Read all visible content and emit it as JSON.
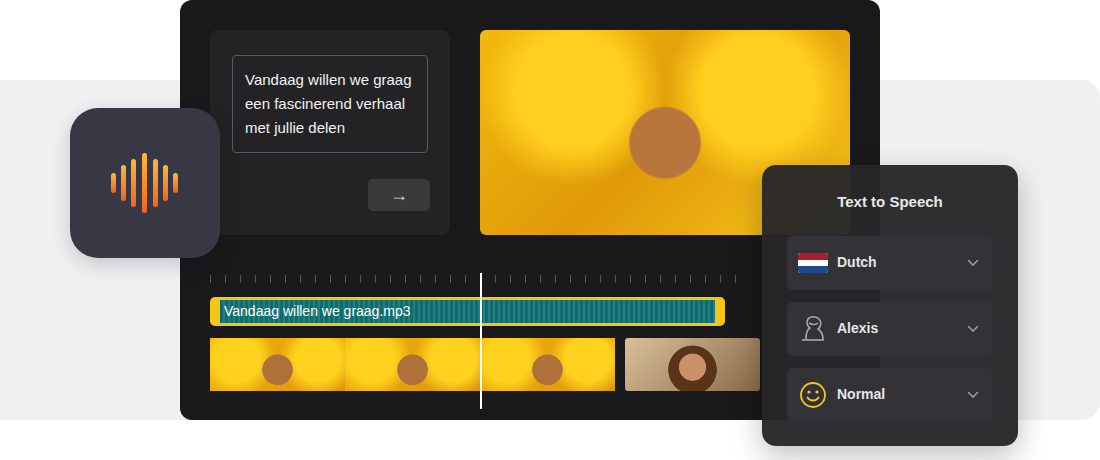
{
  "editor": {
    "script_text": "Vandaag willen we graag een fascinerend verhaal met jullie delen",
    "submit_button": "→"
  },
  "timeline": {
    "audio_clip": "Vandaag willen we graag.mp3",
    "playhead": {
      "level": 0.49
    },
    "clips": [
      {
        "kind": "sunflower"
      },
      {
        "kind": "sunflower"
      },
      {
        "kind": "sunflower"
      },
      {
        "kind": "portrait"
      }
    ]
  },
  "text_to_speech": {
    "title": "Text to Speech",
    "selects": [
      {
        "label": "Dutch",
        "kind": "language"
      },
      {
        "label": "Alexis",
        "kind": "voice"
      },
      {
        "label": "Normal",
        "kind": "emotion"
      }
    ]
  }
}
